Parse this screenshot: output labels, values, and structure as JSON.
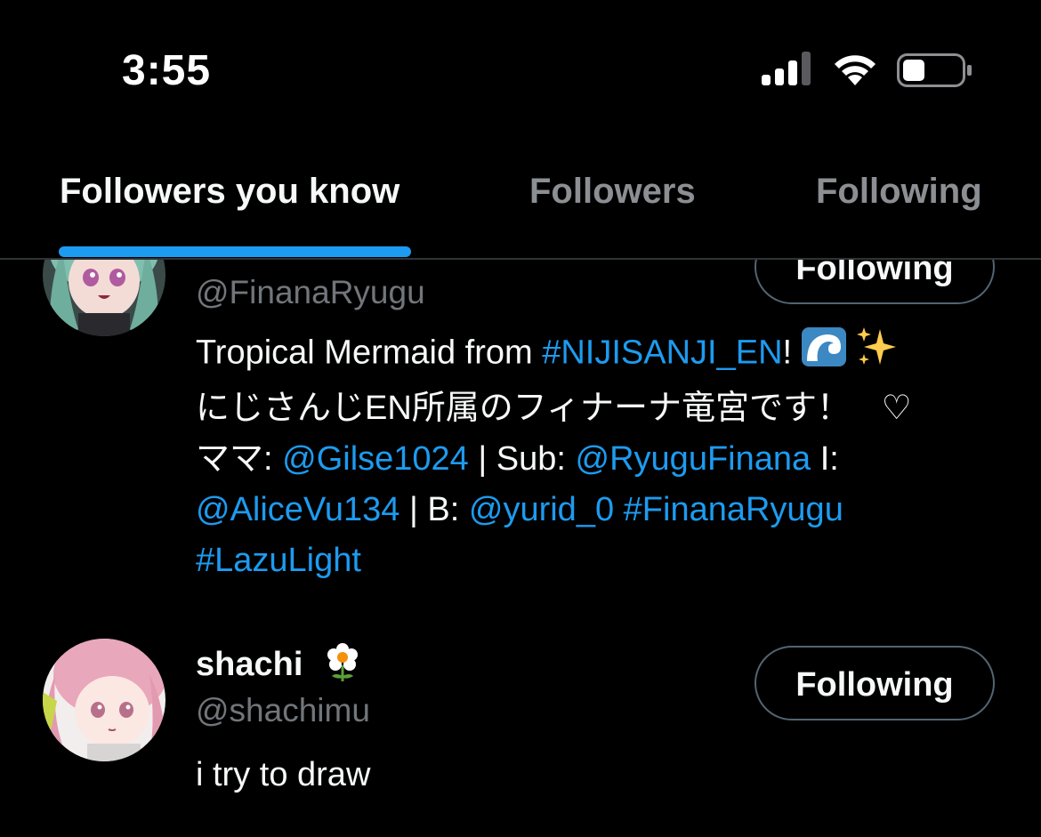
{
  "status_bar": {
    "time": "3:55",
    "signal_icon": "cellular-signal-icon",
    "wifi_icon": "wifi-icon",
    "battery_icon": "battery-icon"
  },
  "tabs": [
    {
      "label": "Followers you know",
      "active": true
    },
    {
      "label": "Followers",
      "active": false
    },
    {
      "label": "Following",
      "active": false
    }
  ],
  "colors": {
    "accent": "#1d9bf0",
    "background": "#000000",
    "secondary_text": "#71767b"
  },
  "users": [
    {
      "handle": "@FinanaRyugu",
      "button_label": "Following",
      "bio": {
        "line1_text": "Tropical Mermaid from ",
        "line1_link": "#NIJISANJI_EN",
        "line1_after": "!",
        "line1_emoji": [
          "wave-emoji",
          "sparkles-emoji"
        ],
        "line2_text": "にじさんじEN所属のフィナーナ竜宮です！",
        "line2_symbol": "♡",
        "line3_prefix": "ママ: ",
        "line3_link1": "@Gilse1024",
        "line3_mid": " | Sub: ",
        "line3_link2": "@RyuguFinana",
        "line3_suffix": " I:",
        "line4_link1": "@AliceVu134",
        "line4_mid": " | B: ",
        "line4_link2": "@yurid_0",
        "line4_link3": "#FinanaRyugu",
        "line5_link": "#LazuLight"
      }
    },
    {
      "display_name": "shachi",
      "name_emoji": "white-flower-emoji",
      "handle": "@shachimu",
      "button_label": "Following",
      "bio_text": "i try to draw"
    }
  ]
}
